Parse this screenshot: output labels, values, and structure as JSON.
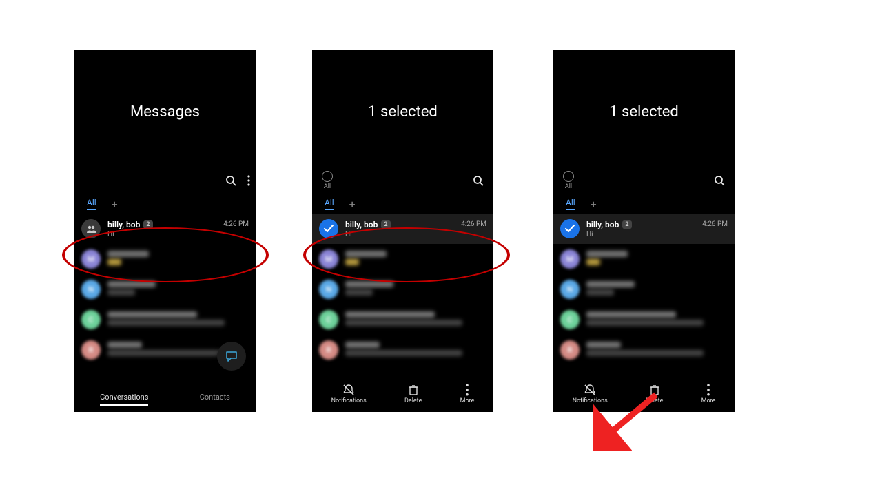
{
  "phones": {
    "p1": {
      "title": "Messages",
      "tab_all": "All"
    },
    "p2": {
      "title": "1 selected",
      "all_label": "All",
      "tab_all": "All"
    },
    "p3": {
      "title": "1 selected",
      "all_label": "All",
      "tab_all": "All"
    }
  },
  "conversation": {
    "name": "billy, bob",
    "badge": "2",
    "preview": "Hi",
    "time": "4:26 PM"
  },
  "avatars": {
    "m": "M",
    "n": "N",
    "c": "C",
    "r": "R"
  },
  "bottom": {
    "conversations": "Conversations",
    "contacts": "Contacts"
  },
  "actions": {
    "notifications": "Notifications",
    "delete": "Delete",
    "more": "More"
  }
}
